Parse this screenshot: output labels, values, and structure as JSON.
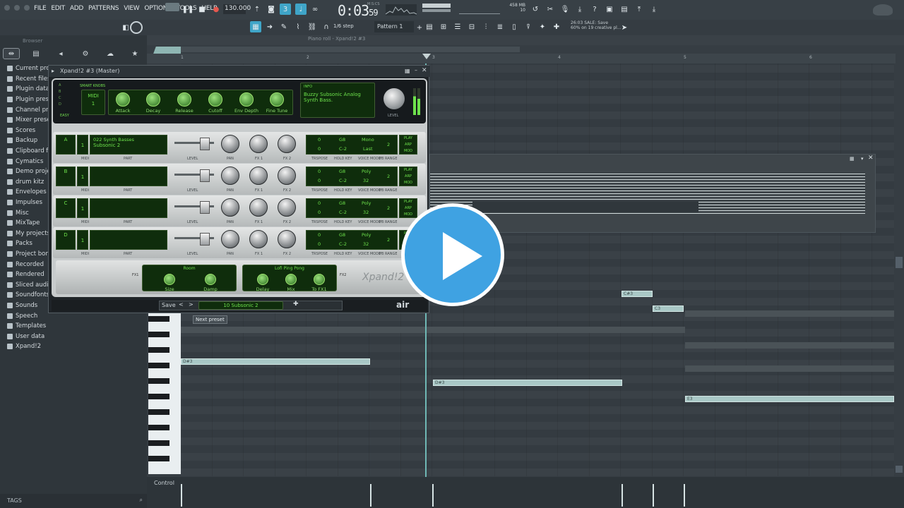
{
  "menu": [
    "FILE",
    "EDIT",
    "ADD",
    "PATTERNS",
    "VIEW",
    "OPTIONS",
    "TOOLS",
    "HELP"
  ],
  "transport": {
    "tempo": "130.000",
    "time": "0:03",
    "time_small": "59",
    "time_label": "M:S:CS"
  },
  "cpu": {
    "mem": "458 MB",
    "poly": "10"
  },
  "toolbar2": {
    "snap": "1/6 step",
    "pattern": "Pattern 1",
    "news_time": "26:03",
    "news_line1": "SALE: Save",
    "news_line2": "60% on 19 creative pl..."
  },
  "browser": {
    "title": "Browser",
    "items": [
      "Current pro",
      "Recent files",
      "Plugin data",
      "Plugin pres",
      "Channel pr",
      "Mixer prese",
      "Scores",
      "Backup",
      "Clipboard f",
      "Cymatics",
      "Demo proje",
      "drum kitz",
      "Envelopes",
      "Impulses",
      "Misc",
      "MixTape",
      "My projects",
      "Packs",
      "Project bon",
      "Recorded",
      "Rendered",
      "Sliced audi",
      "Soundfonts",
      "Sounds",
      "Speech",
      "Templates",
      "User data",
      "Xpand!2"
    ],
    "tags_label": "TAGS"
  },
  "pianoroll": {
    "title": "Piano roll - Xpand!2 #3",
    "control_label": "Control",
    "tooltip": "Next preset",
    "bar_numbers": [
      "1",
      "2",
      "3",
      "4",
      "5",
      "6"
    ]
  },
  "plugin": {
    "title": "Xpand!2 #3 (Master)",
    "smart_knobs_label": "SMART KNOBS",
    "midi_label": "MIDI",
    "midi_value": "1",
    "easy_label": "EASY",
    "knobs": [
      "Attack",
      "Decay",
      "Release",
      "Cutoff",
      "Env Depth",
      "Fine Tune"
    ],
    "info_label": "INFO",
    "info_text": "Buzzy Subsonic Analog Synth Bass.",
    "level_label": "LEVEL",
    "parts": [
      {
        "letter": "A",
        "midi": "1",
        "name1": "022 Synth Basses",
        "name2": "Subsonic 2",
        "transp": "0",
        "hikey": "G8",
        "lokey": "C-2",
        "mode": "Mono",
        "last": "Last",
        "pb": "2"
      },
      {
        "letter": "B",
        "midi": "1",
        "name1": "",
        "name2": "",
        "transp": "0",
        "hikey": "G8",
        "lokey": "C-2",
        "mode": "Poly",
        "last": "32",
        "pb": "2"
      },
      {
        "letter": "C",
        "midi": "1",
        "name1": "",
        "name2": "",
        "transp": "0",
        "hikey": "G8",
        "lokey": "C-2",
        "mode": "Poly",
        "last": "32",
        "pb": "2"
      },
      {
        "letter": "D",
        "midi": "1",
        "name1": "",
        "name2": "",
        "transp": "0",
        "hikey": "G8",
        "lokey": "C-2",
        "mode": "Poly",
        "last": "32",
        "pb": "2"
      }
    ],
    "part_labels": {
      "midi": "MIDI",
      "part": "PART",
      "level": "LEVEL",
      "pan": "PAN",
      "fx1": "FX 1",
      "fx2": "FX 2",
      "transp": "TRSPOSE",
      "holdkey": "HOLD KEY",
      "voicemode": "VOICE MODE",
      "pbrange": "PB RANGE",
      "play": "PLAY",
      "arp": "ARP",
      "mod": "MOD"
    },
    "fx1": {
      "name": "Room",
      "k1": "Size",
      "k2": "Damp"
    },
    "fx2": {
      "name": "Lofi Ping Pong",
      "k1": "Delay",
      "k2": "Mix",
      "k3": "To FX1"
    },
    "fx1_tag": "FX1",
    "fx2_tag": "FX2",
    "brand": "Xpand!2",
    "save_label": "Save",
    "preset_name": "10 Subsonic 2",
    "air_logo": "air"
  },
  "notes": [
    "C#3",
    "C3",
    "D#3",
    "D#3",
    "E3",
    "C#3"
  ]
}
